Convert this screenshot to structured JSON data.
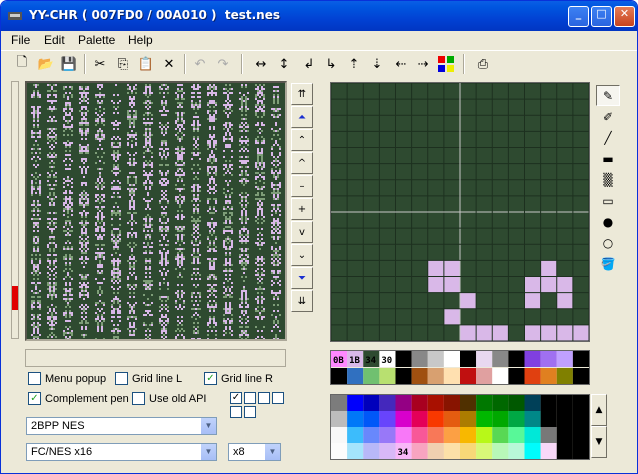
{
  "window": {
    "title": "YY-CHR ( 007FD0 / 00A010 )  test.nes"
  },
  "menu": [
    {
      "label": "File"
    },
    {
      "label": "Edit"
    },
    {
      "label": "Palette"
    },
    {
      "label": "Help"
    }
  ],
  "toolbar": [
    "new-file",
    "open",
    "save",
    "cut",
    "copy",
    "paste",
    "delete",
    "undo",
    "redo",
    "flip-horizontal",
    "flip-vertical",
    "rotate-left",
    "rotate-right",
    "shift-up",
    "shift-down",
    "shift-left",
    "shift-right",
    "replace-color",
    "palette-info"
  ],
  "colors": {
    "tile_bg": "#2e4a30",
    "tile_fg": "#d9b8e8",
    "tile_mid": "#7e9e78",
    "grid_line": "#1d301f"
  },
  "nav_buttons": [
    "top",
    "page-up-fast",
    "page-up",
    "up",
    "minus",
    "plus",
    "down",
    "page-down",
    "page-down-fast",
    "bottom"
  ],
  "options": {
    "menu_popup": {
      "label": "Menu popup",
      "checked": false
    },
    "grid_line_l": {
      "label": "Grid line L",
      "checked": false
    },
    "grid_line_r": {
      "label": "Grid line R",
      "checked": true
    },
    "complement_pen": {
      "label": "Complement pen",
      "checked": true
    },
    "use_old_api": {
      "label": "Use old API",
      "checked": false
    }
  },
  "format_select": {
    "value": "2BPP NES"
  },
  "pattern_select": {
    "value": "FC/NES x16"
  },
  "zoom_select": {
    "value": "x8"
  },
  "palette_set": {
    "labels": [
      "0B",
      "1B",
      "34",
      "30"
    ],
    "colors": [
      "#ff88ff",
      "#d9b8e8",
      "#2e4a30",
      "#ffffff"
    ]
  },
  "palette_row_labels": {
    "selected_index": "34"
  },
  "pixel_art": {
    "cols": 16,
    "rows": 16,
    "pattern": [
      "................",
      "................",
      "................",
      "................",
      "................",
      "................",
      "................",
      "................",
      "................",
      "................",
      "................",
      "......bb.....b..",
      "......bb....bbb.",
      "........b...b.b.",
      ".......b........",
      "........bbb.bbbb"
    ]
  }
}
